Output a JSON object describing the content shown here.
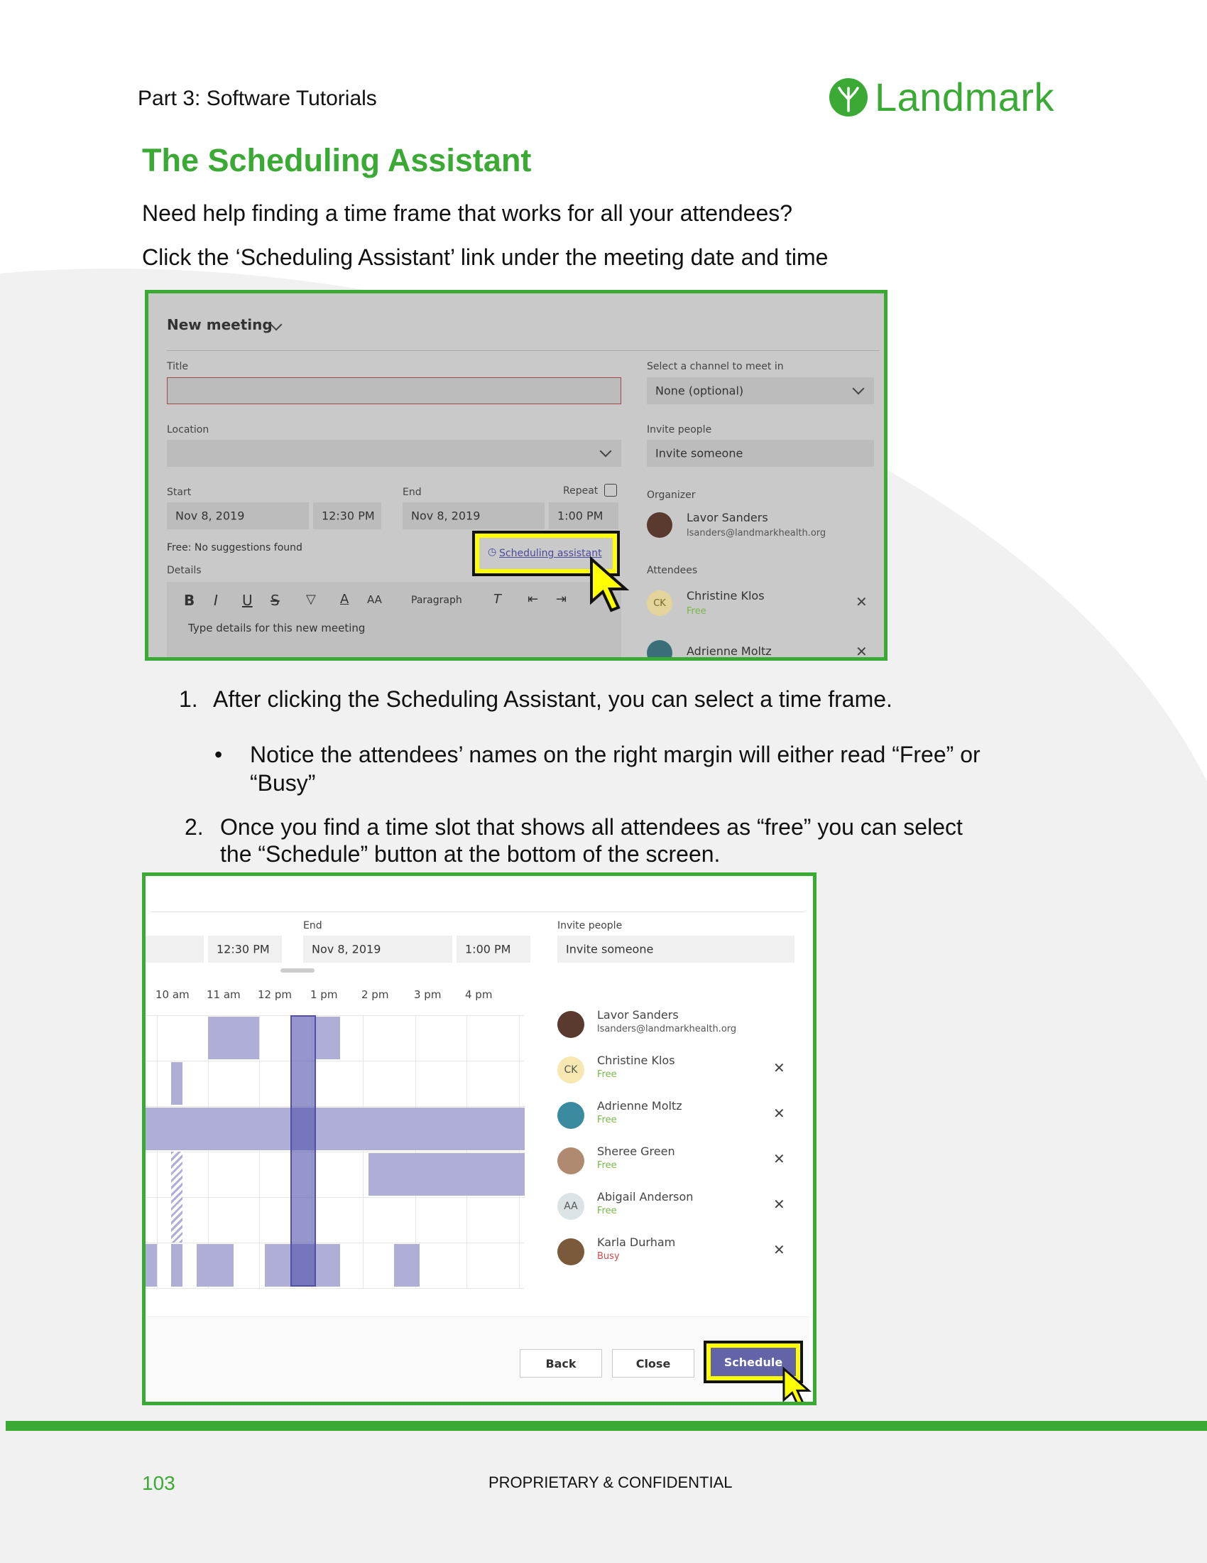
{
  "header": {
    "part": "Part 3: Software Tutorials",
    "logo_text": "Landmark"
  },
  "title": "The Scheduling Assistant",
  "intro": [
    "Need help finding a time frame that works for all your attendees?",
    "Click the ‘Scheduling Assistant’ link under the meeting date and time"
  ],
  "screenshot1": {
    "heading": "New meeting",
    "title_label": "Title",
    "location_label": "Location",
    "channel_label": "Select a channel to meet in",
    "channel_value": "None (optional)",
    "invite_label": "Invite people",
    "invite_placeholder": "Invite someone",
    "start_label": "Start",
    "end_label": "End",
    "repeat_label": "Repeat",
    "start_date": "Nov 8, 2019",
    "start_time": "12:30 PM",
    "end_date": "Nov 8, 2019",
    "end_time": "1:00 PM",
    "free_text": "Free: No suggestions found",
    "scheduling_link": "Scheduling assistant",
    "details_label": "Details",
    "toolbar_paragraph": "Paragraph",
    "details_placeholder": "Type details for this new meeting",
    "organizer_label": "Organizer",
    "organizer_name": "Lavor Sanders",
    "organizer_email": "lsanders@landmarkhealth.org",
    "attendees_label": "Attendees",
    "attendees": [
      {
        "name": "Christine Klos",
        "status": "Free",
        "initials": "CK"
      },
      {
        "name": "Adrienne Moltz",
        "status": ""
      }
    ]
  },
  "steps": {
    "step1_num": "1.",
    "step1": "After clicking the Scheduling Assistant, you can select a time frame.",
    "bullet": "Notice the attendees’ names on the right margin will either read “Free” or",
    "bullet_cont": "“Busy”",
    "step2_num": "2.",
    "step2": "Once you find a time slot that shows all attendees as “free” you can select",
    "step2_cont": "the “Schedule” button at the bottom of the  screen."
  },
  "screenshot2": {
    "end_label": "End",
    "invite_label": "Invite people",
    "start_time": "12:30 PM",
    "end_date": "Nov 8, 2019",
    "end_time": "1:00 PM",
    "invite_placeholder": "Invite someone",
    "times": [
      "10 am",
      "11 am",
      "12 pm",
      "1 pm",
      "2 pm",
      "3 pm",
      "4 pm"
    ],
    "people": [
      {
        "name": "Lavor Sanders",
        "sub": "lsanders@landmarkhealth.org",
        "initials": "",
        "removable": false
      },
      {
        "name": "Christine Klos",
        "sub": "Free",
        "initials": "CK",
        "removable": true
      },
      {
        "name": "Adrienne Moltz",
        "sub": "Free",
        "initials": "",
        "removable": true
      },
      {
        "name": "Sheree Green",
        "sub": "Free",
        "initials": "",
        "removable": true
      },
      {
        "name": "Abigail Anderson",
        "sub": "Free",
        "initials": "AA",
        "removable": true
      },
      {
        "name": "Karla Durham",
        "sub": "Busy",
        "initials": "",
        "removable": true
      }
    ],
    "buttons": {
      "back": "Back",
      "close": "Close",
      "schedule": "Schedule"
    }
  },
  "footer": {
    "page_number": "103",
    "confidential": "PROPRIETARY & CONFIDENTIAL"
  },
  "colors": {
    "brand_green": "#3aaa35",
    "busy": "#d04a4a",
    "free": "#7ab648",
    "highlight": "#ffff00",
    "schedule_purple": "#6264a7"
  }
}
